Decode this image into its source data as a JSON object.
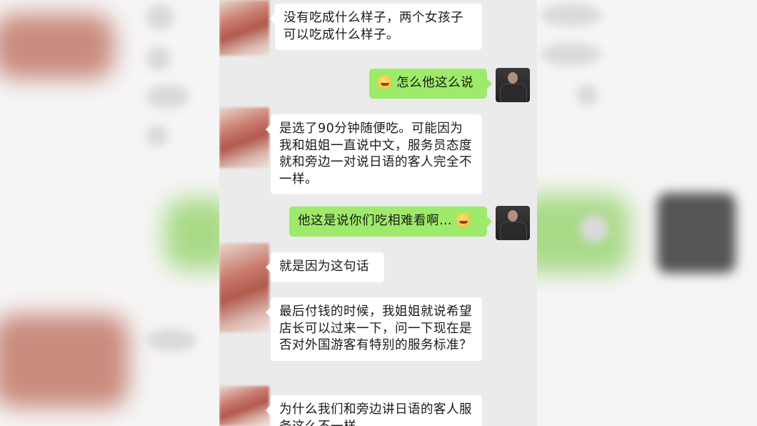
{
  "chat": {
    "messages": [
      {
        "side": "in",
        "text": "没有吃成什么样子，两个女孩子可以吃成什么样子。"
      },
      {
        "side": "out",
        "text": "怎么他这么说",
        "emoji": "sweat-smile-emoji",
        "emoji_position": "before"
      },
      {
        "side": "in",
        "text": "是选了90分钟随便吃。可能因为我和姐姐一直说中文，服务员态度就和旁边一对说日语的客人完全不一样。"
      },
      {
        "side": "out",
        "text": "他这是说你们吃相难看啊…",
        "emoji": "sweat-smile-emoji",
        "emoji_position": "after"
      },
      {
        "side": "in",
        "text": "就是因为这句话"
      },
      {
        "side": "in",
        "text": "最后付钱的时候，我姐姐就说希望店长可以过来一下，问一下现在是否对外国游客有特别的服务标准？"
      },
      {
        "side": "in",
        "text": "为什么我们和旁边讲日语的客人服务这么不一样"
      }
    ]
  },
  "colors": {
    "chat_background": "#ebebeb",
    "incoming_bubble": "#ffffff",
    "outgoing_bubble": "#9eea6a"
  }
}
